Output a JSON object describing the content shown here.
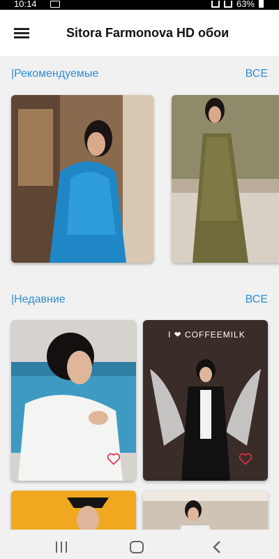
{
  "status_bar": {
    "time": "10:14",
    "battery": "63%"
  },
  "app_bar": {
    "title": "Sitora Farmonova HD обои"
  },
  "sections": {
    "featured": {
      "title": "|Рекомендуемые",
      "all_label": "ВСЕ"
    },
    "recent": {
      "title": "|Недавние",
      "all_label": "ВСЕ"
    }
  },
  "images": {
    "featured_1_bg": "#8a6a4e",
    "featured_2_bg": "#b9ad9a",
    "recent_1_bg": "#d6d3cf",
    "recent_2_bg": "#3a2c28",
    "recent_2_sign": "I ❤ COFFEEMILK"
  },
  "colors": {
    "accent": "#2b8fd6",
    "heart": "#e0304a",
    "nav": "#666666"
  },
  "icons": [
    "menu-icon",
    "heart-icon",
    "nav-recent-icon",
    "nav-home-icon",
    "nav-back-icon"
  ]
}
